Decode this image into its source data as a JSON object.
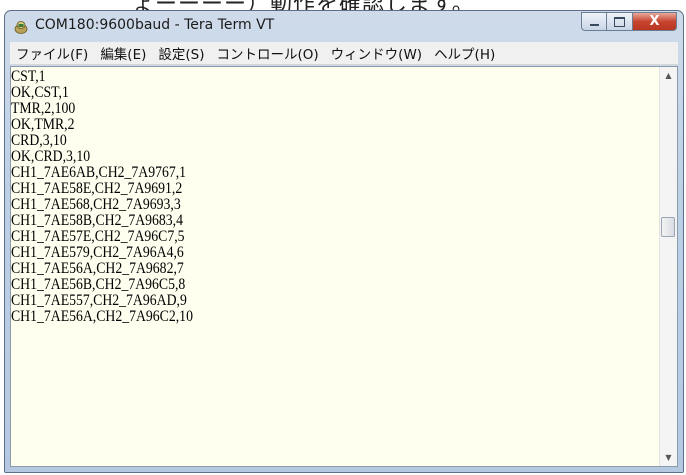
{
  "top_text": "ょーーーー）動作を確認します。",
  "window": {
    "title": "COM180:9600baud - Tera Term VT",
    "app_icon": "tera-term-icon",
    "caption_buttons": {
      "minimize": "minimize-icon",
      "maximize": "maximize-icon",
      "close_label": "X"
    }
  },
  "menu": [
    "ファイル(F)",
    "編集(E)",
    "設定(S)",
    "コントロール(O)",
    "ウィンドウ(W)",
    "ヘルプ(H)"
  ],
  "terminal_lines": [
    "CST,1",
    "OK,CST,1",
    "TMR,2,100",
    "OK,TMR,2",
    "CRD,3,10",
    "OK,CRD,3,10",
    "CH1_7AE6AB,CH2_7A9767,1",
    "CH1_7AE58E,CH2_7A9691,2",
    "CH1_7AE568,CH2_7A9693,3",
    "CH1_7AE58B,CH2_7A9683,4",
    "CH1_7AE57E,CH2_7A96C7,5",
    "CH1_7AE579,CH2_7A96A4,6",
    "CH1_7AE56A,CH2_7A9682,7",
    "CH1_7AE56B,CH2_7A96C5,8",
    "CH1_7AE557,CH2_7A96AD,9",
    "CH1_7AE56A,CH2_7A96C2,10"
  ],
  "scrollbar": {
    "up_icon": "arrow-up-icon",
    "down_icon": "arrow-down-icon",
    "position": 0.38
  }
}
